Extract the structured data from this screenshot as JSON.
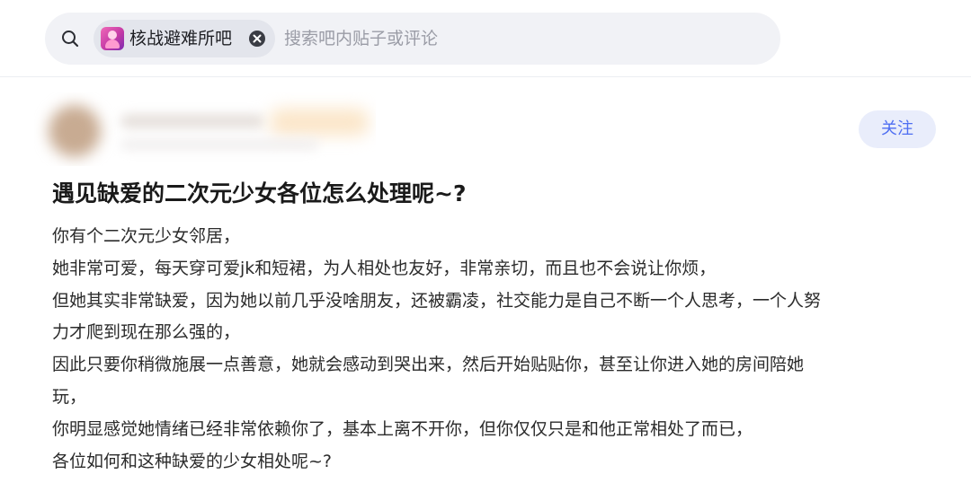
{
  "search": {
    "forum_chip_name": "核战避难所吧",
    "placeholder": "搜索吧内贴子或评论",
    "icons": {
      "search": "search-icon",
      "chip_close": "close-circle-icon",
      "forum_avatar": "forum-avatar-image"
    }
  },
  "post": {
    "follow_label": "关注",
    "title": "遇见缺爱的二次元少女各位怎么处理呢~?",
    "body_lines": [
      "你有个二次元少女邻居，",
      "她非常可爱，每天穿可爱jk和短裙，为人相处也友好，非常亲切，而且也不会说让你烦，",
      "但她其实非常缺爱，因为她以前几乎没啥朋友，还被霸凌，社交能力是自己不断一个人思考，一个人努",
      "力才爬到现在那么强的，",
      "因此只要你稍微施展一点善意，她就会感动到哭出来，然后开始贴贴你，甚至让你进入她的房间陪她",
      "玩，",
      "你明显感觉她情绪已经非常依赖你了，基本上离不开你，但你仅仅只是和他正常相处了而已，",
      "各位如何和这种缺爱的少女相处呢~?"
    ]
  },
  "colors": {
    "accent": "#4e6ef2",
    "follow_bg": "#e9edfb",
    "search_bg": "#f1f2f6",
    "chip_bg": "#e3e5ec",
    "placeholder": "#9a9ca6"
  }
}
